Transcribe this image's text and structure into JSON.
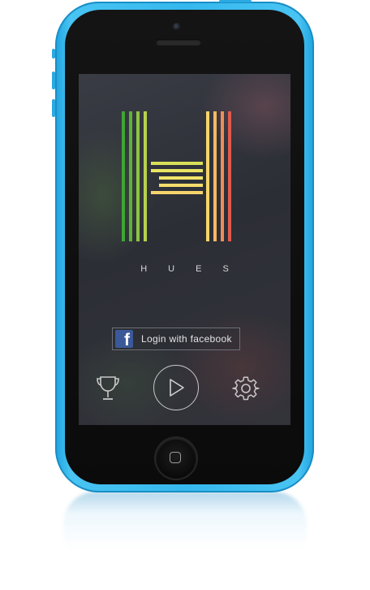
{
  "app": {
    "brand_name": "HUES",
    "logo_letter": "H",
    "colors": {
      "shell": "#35b8ee",
      "screen_background": "#2f3139",
      "facebook_blue": "#3b5998",
      "logo_stripes": [
        "#3fa535",
        "#7fc243",
        "#c8d84a",
        "#f2e86a",
        "#f6d86c",
        "#f4b865",
        "#ee8d5a",
        "#e05a4b"
      ]
    }
  },
  "login": {
    "facebook_icon_glyph": "f",
    "facebook_label": "Login with facebook"
  },
  "controls": {
    "left_icon": "trophy-icon",
    "center_icon": "play-icon",
    "right_icon": "gear-icon"
  },
  "device": {
    "home_button_icon": "home-square-icon"
  }
}
